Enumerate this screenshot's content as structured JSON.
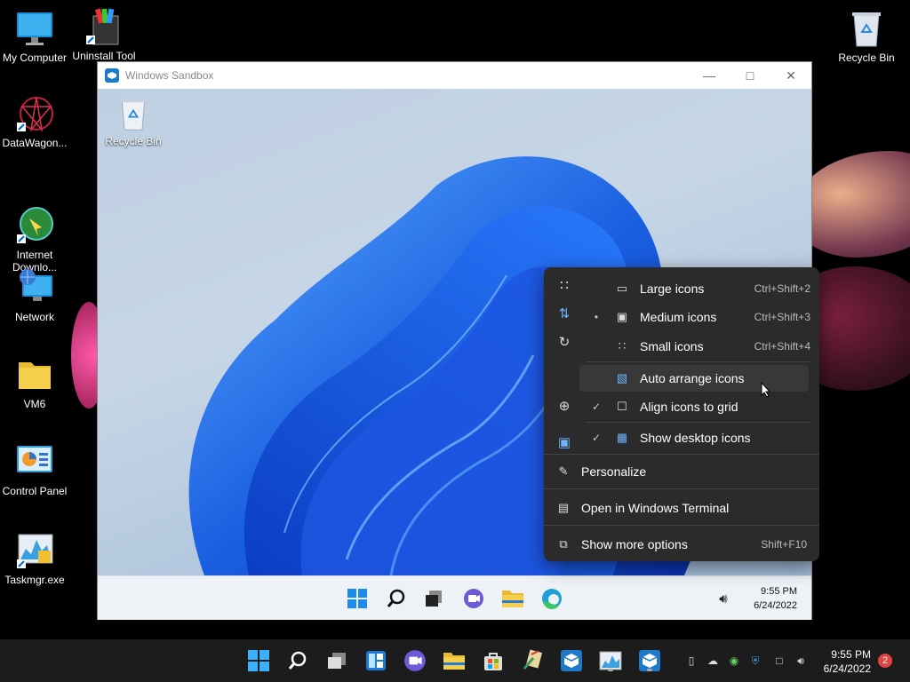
{
  "desktop": {
    "icons": [
      {
        "label": "My Computer",
        "icon": "monitor-icon"
      },
      {
        "label": "Uninstall Tool",
        "icon": "uninstall-tool-icon"
      },
      {
        "label": "DataWagon...",
        "icon": "datawagon-icon"
      },
      {
        "label": "Internet\nDownlo...",
        "icon": "internet-download-icon"
      },
      {
        "label": "Network",
        "icon": "network-icon"
      },
      {
        "label": "VM6",
        "icon": "folder-icon"
      },
      {
        "label": "Control Panel",
        "icon": "control-panel-icon"
      },
      {
        "label": "Taskmgr.exe",
        "icon": "taskmgr-icon"
      },
      {
        "label": "Recycle Bin",
        "icon": "recycle-bin-icon"
      }
    ]
  },
  "sandbox": {
    "title": "Windows Sandbox",
    "desktop_icon_label": "Recycle Bin",
    "clock_time": "9:55 PM",
    "clock_date": "6/24/2022"
  },
  "menu": {
    "view": [
      {
        "label": "Large icons",
        "shortcut": "Ctrl+Shift+2",
        "checked": false,
        "bullet": false
      },
      {
        "label": "Medium icons",
        "shortcut": "Ctrl+Shift+3",
        "checked": false,
        "bullet": true
      },
      {
        "label": "Small icons",
        "shortcut": "Ctrl+Shift+4",
        "checked": false,
        "bullet": false
      },
      {
        "label": "Auto arrange icons",
        "shortcut": "",
        "checked": false,
        "bullet": false
      },
      {
        "label": "Align icons to grid",
        "shortcut": "",
        "checked": true,
        "bullet": false
      },
      {
        "label": "Show desktop icons",
        "shortcut": "",
        "checked": true,
        "bullet": false
      }
    ],
    "personalize": "Personalize",
    "terminal": "Open in Windows Terminal",
    "more_options": "Show more options",
    "more_options_shortcut": "Shift+F10",
    "bullet_glyph": "•",
    "check_glyph": "✓"
  },
  "taskbar": {
    "clock_time": "9:55 PM",
    "clock_date": "6/24/2022",
    "notification_count": "2"
  },
  "colors": {
    "accent": "#0078d4",
    "menu_bg": "#2b2b2b",
    "taskbar_bg": "#1c1c1c"
  }
}
